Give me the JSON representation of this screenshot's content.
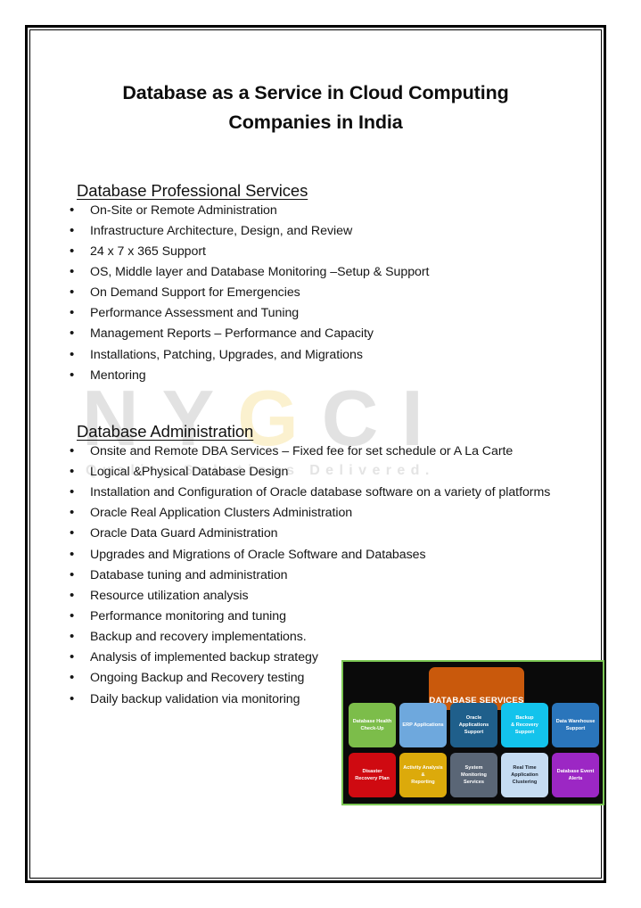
{
  "document": {
    "title": "Database as a Service in Cloud Computing Companies in India"
  },
  "watermark": {
    "letters": [
      "N",
      "Y",
      "G",
      "C",
      "I"
    ],
    "gold_letter": "G",
    "tagline": "Quality Solutions Delivered.",
    "grey_color": "#e2e2e2",
    "gold_color": "#fbf1cf"
  },
  "sections": [
    {
      "heading": "Database Professional Services",
      "bullets": [
        "On-Site or Remote Administration",
        "Infrastructure Architecture, Design, and Review",
        "24 x 7 x 365 Support",
        "OS, Middle layer and Database Monitoring –Setup & Support",
        "On Demand Support for Emergencies",
        "Performance Assessment and Tuning",
        "Management Reports – Performance and Capacity",
        "Installations, Patching, Upgrades, and Migrations",
        "Mentoring"
      ]
    },
    {
      "heading": "Database Administration",
      "bullets": [
        "Onsite and Remote DBA Services – Fixed fee for set schedule or A La Carte",
        "Logical &Physical Database Design",
        "Installation and Configuration of Oracle database software on a variety of platforms",
        "Oracle Real Application Clusters Administration",
        "Oracle Data Guard Administration",
        "Upgrades and Migrations of Oracle Software and Databases",
        "Database tuning and administration",
        "Resource utilization analysis",
        "Performance monitoring and tuning",
        "Backup and recovery implementations.",
        "Analysis of implemented backup strategy",
        "Ongoing Backup and Recovery testing",
        "Daily backup validation via monitoring"
      ]
    }
  ],
  "services_diagram": {
    "banner_label": "DATABASE SERVICES",
    "banner_color": "#c9590c",
    "frame_color": "#7cc854",
    "background_color": "#0a0a0a",
    "top_row": [
      {
        "label": "Database Health\nCheck-Up",
        "color": "#7cbd4a",
        "text_color": "#ffffff"
      },
      {
        "label": "ERP Applications",
        "color": "#6ea8dd",
        "text_color": "#ffffff"
      },
      {
        "label": "Oracle\nApplications\nSupport",
        "color": "#1f5f8b",
        "text_color": "#ffffff"
      },
      {
        "label": "Backup\n& Recovery\nSupport",
        "color": "#13c3ec",
        "text_color": "#ffffff"
      },
      {
        "label": "Data Warehouse\nSupport",
        "color": "#2a75bb",
        "text_color": "#ffffff"
      }
    ],
    "bottom_row": [
      {
        "label": "Disaster\nRecovery Plan",
        "color": "#cf0a11",
        "text_color": "#ffffff"
      },
      {
        "label": "Activity Analysis\n&\nReporting",
        "color": "#dcaa0b",
        "text_color": "#ffffff"
      },
      {
        "label": "System\nMonitoring\nServices",
        "color": "#5a6676",
        "text_color": "#ffffff"
      },
      {
        "label": "Real Time\nApplication\nClustering",
        "color": "#c6dcf2",
        "text_color": "#1c2430"
      },
      {
        "label": "Database Event\nAlerts",
        "color": "#9c27c4",
        "text_color": "#ffffff"
      }
    ]
  }
}
